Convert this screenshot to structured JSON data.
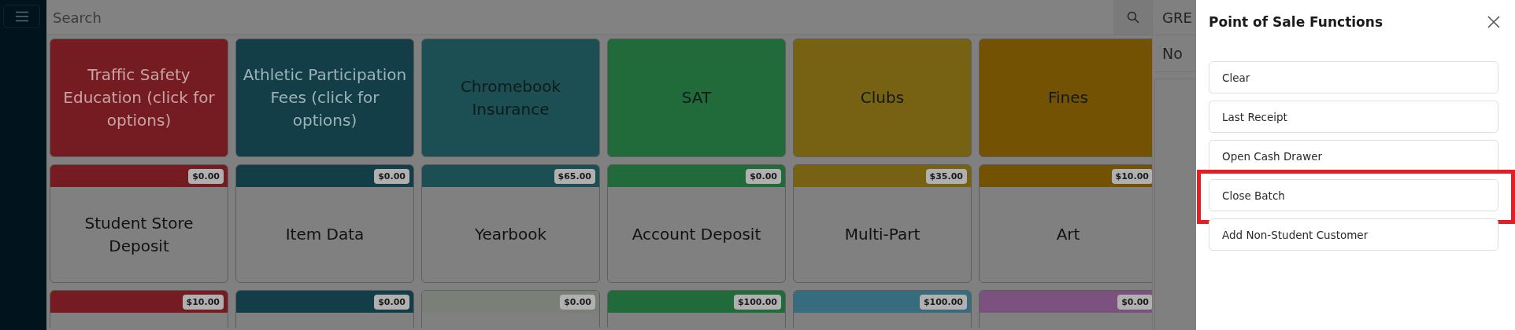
{
  "search": {
    "placeholder": "Search"
  },
  "tiles": [
    {
      "kind": "category",
      "label": "Traffic Safety Education (click for options)",
      "color": "#751c22",
      "muted": true
    },
    {
      "kind": "category",
      "label": "Athletic Participation Fees (click for options)",
      "color": "#133d47",
      "muted": true
    },
    {
      "kind": "category",
      "label": "Chromebook Insurance",
      "color": "#1c4f53",
      "muted": false
    },
    {
      "kind": "category",
      "label": "SAT",
      "color": "#216a3a",
      "muted": false
    },
    {
      "kind": "category",
      "label": "Clubs",
      "color": "#776213",
      "muted": false
    },
    {
      "kind": "category",
      "label": "Fines",
      "color": "#735203",
      "muted": false
    },
    {
      "kind": "item",
      "label": "Student Store Deposit",
      "price": "$0.00",
      "color": "#751c22"
    },
    {
      "kind": "item",
      "label": "Item Data",
      "price": "$0.00",
      "color": "#133d47"
    },
    {
      "kind": "item",
      "label": "Yearbook",
      "price": "$65.00",
      "color": "#1c4f53"
    },
    {
      "kind": "item",
      "label": "Account Deposit",
      "price": "$0.00",
      "color": "#216a3a"
    },
    {
      "kind": "item",
      "label": "Multi-Part",
      "price": "$35.00",
      "color": "#776213"
    },
    {
      "kind": "item",
      "label": "Art",
      "price": "$10.00",
      "color": "#735203"
    },
    {
      "kind": "item",
      "price": "$10.00",
      "color": "#751c22"
    },
    {
      "kind": "item",
      "price": "$0.00",
      "color": "#133d47"
    },
    {
      "kind": "item",
      "price": "$0.00",
      "color": "#7a8078"
    },
    {
      "kind": "item",
      "price": "$100.00",
      "color": "#216a3a"
    },
    {
      "kind": "item",
      "price": "$100.00",
      "color": "#376c7e"
    },
    {
      "kind": "item",
      "price": "$0.00",
      "color": "#7b527d"
    }
  ],
  "customer_panel": {
    "header": "GRE",
    "status": "No"
  },
  "functions_panel": {
    "title": "Point of Sale Functions",
    "items": [
      {
        "label": "Clear",
        "highlighted": false
      },
      {
        "label": "Last Receipt",
        "highlighted": false
      },
      {
        "label": "Open Cash Drawer",
        "highlighted": false
      },
      {
        "label": "Close Batch",
        "highlighted": true
      },
      {
        "label": "Add Non-Student Customer",
        "highlighted": false
      }
    ]
  }
}
